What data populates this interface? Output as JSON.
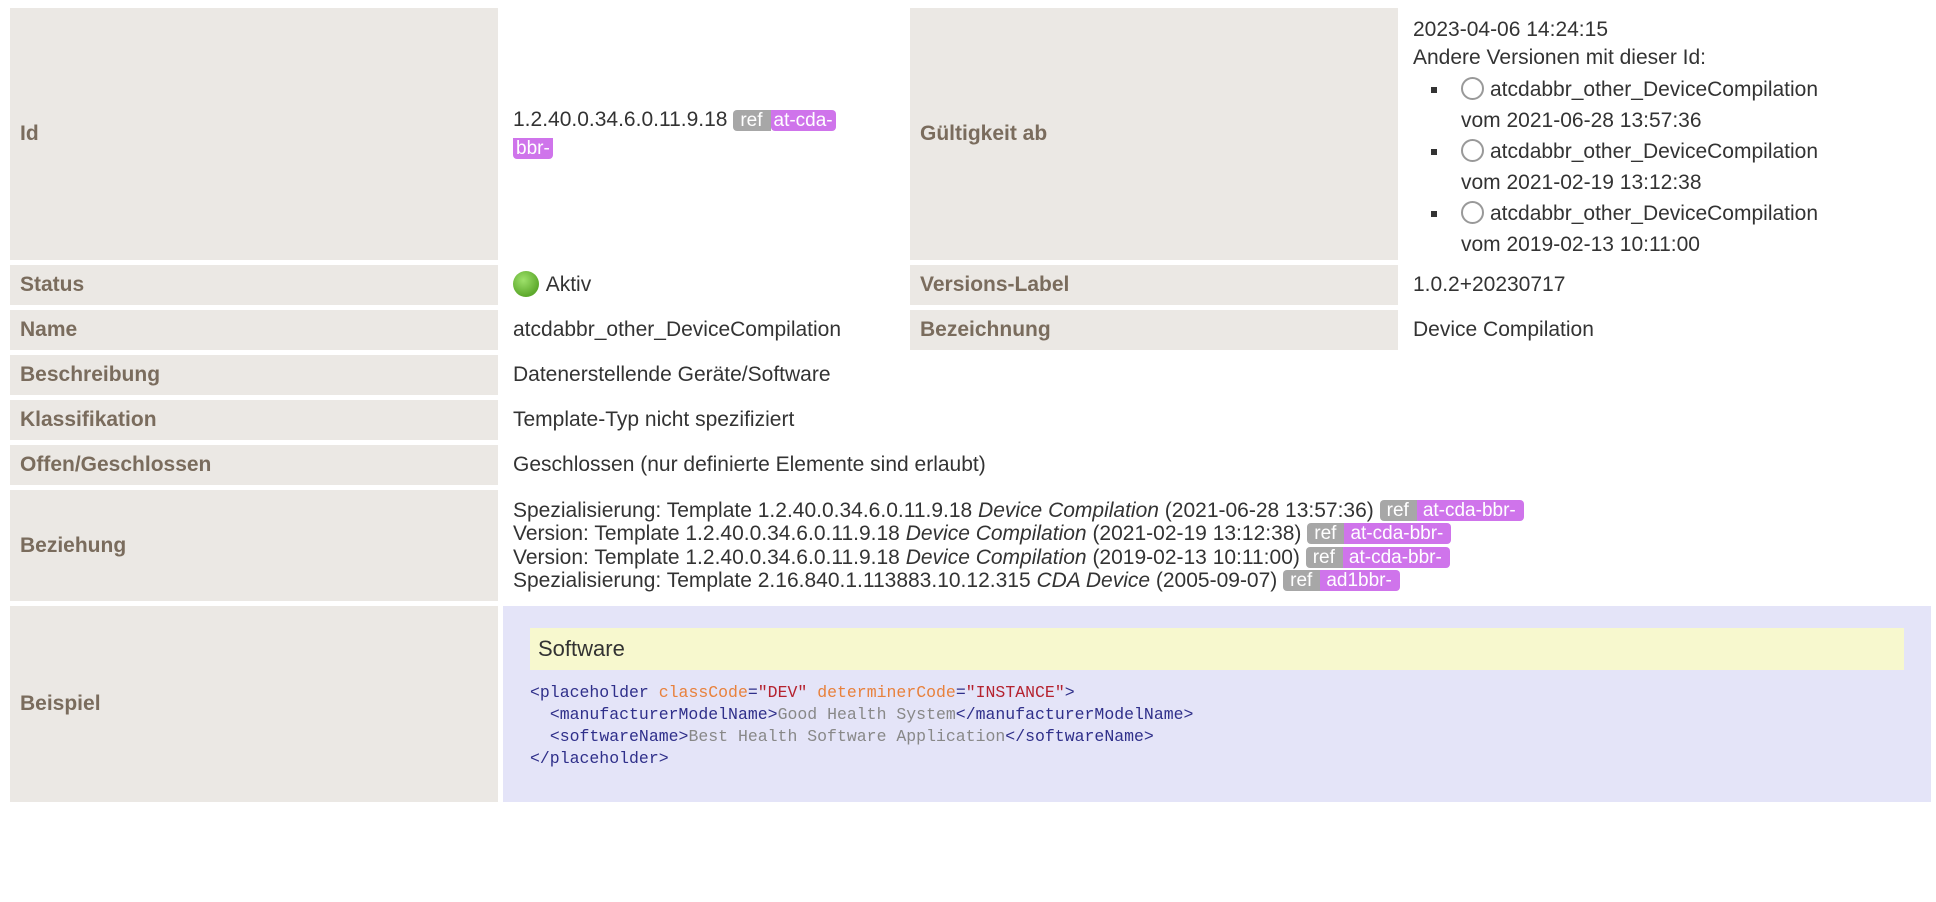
{
  "rows": {
    "id": {
      "label": "Id",
      "value": "1.2.40.0.34.6.0.11.9.18",
      "ref": "ref",
      "prefix_line1": "at-cda-",
      "prefix_line2": "bbr-"
    },
    "effective": {
      "label": "Gültigkeit ab",
      "date": "2023-04-06 14:24:15",
      "other_versions_label": "Andere Versionen mit dieser Id:",
      "versions": [
        {
          "name": "atcdabbr_other_DeviceCompilation",
          "date": "vom 2021-06-28 13:57:36"
        },
        {
          "name": "atcdabbr_other_DeviceCompilation",
          "date": "vom 2021-02-19 13:12:38"
        },
        {
          "name": "atcdabbr_other_DeviceCompilation",
          "date": "vom 2019-02-13 10:11:00"
        }
      ]
    },
    "status": {
      "label": "Status",
      "value": "Aktiv",
      "status_color": "#5da92c"
    },
    "version_label": {
      "label": "Versions-Label",
      "value": "1.0.2+20230717"
    },
    "name": {
      "label": "Name",
      "value": "atcdabbr_other_DeviceCompilation"
    },
    "display_name": {
      "label": "Bezeichnung",
      "value": "Device Compilation"
    },
    "description": {
      "label": "Beschreibung",
      "value": "Datenerstellende Geräte/Software"
    },
    "classification": {
      "label": "Klassifikation",
      "value": "Template-Typ nicht spezifiziert"
    },
    "open_closed": {
      "label": "Offen/Geschlossen",
      "value": "Geschlossen (nur definierte Elemente sind erlaubt)"
    },
    "relationship": {
      "label": "Beziehung",
      "items": [
        {
          "type": "Spezialisierung: Template 1.2.40.0.34.6.0.11.9.18 ",
          "name": "Device Compilation",
          "date": " (2021-06-28 13:57:36) ",
          "ref": "ref",
          "prefix": "at-cda-bbr-"
        },
        {
          "type": "Version: Template 1.2.40.0.34.6.0.11.9.18 ",
          "name": "Device Compilation",
          "date": " (2021-02-19 13:12:38) ",
          "ref": "ref",
          "prefix": "at-cda-bbr-"
        },
        {
          "type": "Version: Template 1.2.40.0.34.6.0.11.9.18 ",
          "name": "Device Compilation",
          "date": " (2019-02-13 10:11:00) ",
          "ref": "ref",
          "prefix": "at-cda-bbr-"
        },
        {
          "type": "Spezialisierung: Template 2.16.840.1.113883.10.12.315 ",
          "name": "CDA Device",
          "date": " (2005-09-07) ",
          "ref": "ref",
          "prefix": "ad1bbr-"
        }
      ]
    },
    "example": {
      "label": "Beispiel",
      "title": "Software",
      "code": {
        "l1_open": "<placeholder",
        "l1_attr1": "classCode",
        "l1_eq1": "=",
        "l1_val1": "\"DEV\"",
        "l1_attr2": "determinerCode",
        "l1_eq2": "=",
        "l1_val2": "\"INSTANCE\"",
        "l1_close": ">",
        "l2_open": "<manufacturerModelName>",
        "l2_text": "Good Health System",
        "l2_close": "</manufacturerModelName>",
        "l3_open": "<softwareName>",
        "l3_text": "Best Health Software Application",
        "l3_close": "</softwareName>",
        "l4_close": "</placeholder>"
      }
    }
  }
}
